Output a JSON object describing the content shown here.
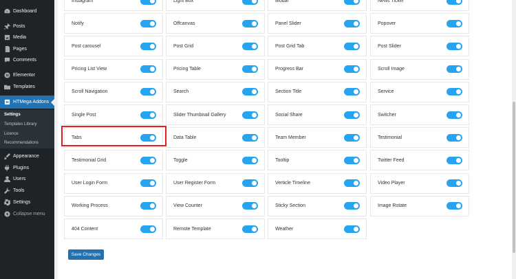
{
  "sidebar": {
    "items": [
      {
        "label": "Dashboard",
        "icon": "dashboard-icon"
      },
      {
        "label": "Posts",
        "icon": "pin-icon"
      },
      {
        "label": "Media",
        "icon": "media-icon"
      },
      {
        "label": "Pages",
        "icon": "pages-icon"
      },
      {
        "label": "Comments",
        "icon": "comment-icon"
      },
      {
        "label": "Elementor",
        "icon": "elementor-icon"
      },
      {
        "label": "Templates",
        "icon": "folder-icon"
      },
      {
        "label": "HTMega Addons",
        "icon": "htmega-icon"
      },
      {
        "label": "Appearance",
        "icon": "brush-icon"
      },
      {
        "label": "Plugins",
        "icon": "plugin-icon"
      },
      {
        "label": "Users",
        "icon": "user-icon"
      },
      {
        "label": "Tools",
        "icon": "wrench-icon"
      },
      {
        "label": "Settings",
        "icon": "settings-icon"
      },
      {
        "label": "Collapse menu",
        "icon": "collapse-icon"
      }
    ],
    "submenu": [
      "Settings",
      "Templates Library",
      "Licence",
      "Recommendations"
    ]
  },
  "widgets": [
    [
      {
        "label": "Instagram",
        "on": true
      },
      {
        "label": "Light Box",
        "on": true
      },
      {
        "label": "Modal",
        "on": true
      },
      {
        "label": "News Ticker",
        "on": true
      }
    ],
    [
      {
        "label": "Notify",
        "on": true
      },
      {
        "label": "Offcanvas",
        "on": true
      },
      {
        "label": "Panel Slider",
        "on": true
      },
      {
        "label": "Popover",
        "on": true
      }
    ],
    [
      {
        "label": "Post carousel",
        "on": true
      },
      {
        "label": "Post Grid",
        "on": true
      },
      {
        "label": "Post Grid Tab",
        "on": true
      },
      {
        "label": "Post Slider",
        "on": true
      }
    ],
    [
      {
        "label": "Pricing List View",
        "on": true
      },
      {
        "label": "Pricing Table",
        "on": true
      },
      {
        "label": "Progress Bar",
        "on": true
      },
      {
        "label": "Scroll Image",
        "on": true
      }
    ],
    [
      {
        "label": "Scroll Navigation",
        "on": true
      },
      {
        "label": "Search",
        "on": true
      },
      {
        "label": "Section Title",
        "on": true
      },
      {
        "label": "Service",
        "on": true
      }
    ],
    [
      {
        "label": "Single Post",
        "on": true
      },
      {
        "label": "Slider Thumbnail Gallery",
        "on": true
      },
      {
        "label": "Social Share",
        "on": true
      },
      {
        "label": "Switcher",
        "on": true
      }
    ],
    [
      {
        "label": "Tabs",
        "on": true
      },
      {
        "label": "Data Table",
        "on": true
      },
      {
        "label": "Team Member",
        "on": true
      },
      {
        "label": "Testimonial",
        "on": true
      }
    ],
    [
      {
        "label": "Testimonial Grid",
        "on": true
      },
      {
        "label": "Toggle",
        "on": true
      },
      {
        "label": "Tooltip",
        "on": true
      },
      {
        "label": "Twitter Feed",
        "on": true
      }
    ],
    [
      {
        "label": "User Login Form",
        "on": true
      },
      {
        "label": "User Register Form",
        "on": true
      },
      {
        "label": "Verticle Timeline",
        "on": true
      },
      {
        "label": "Video Player",
        "on": true
      }
    ],
    [
      {
        "label": "Working Process",
        "on": true
      },
      {
        "label": "View Counter",
        "on": true
      },
      {
        "label": "Sticky Section",
        "on": true
      },
      {
        "label": "Image Rotate",
        "on": true
      }
    ],
    [
      {
        "label": "404 Content",
        "on": true
      },
      {
        "label": "Remote Template",
        "on": true
      },
      {
        "label": "Weather",
        "on": true
      }
    ]
  ],
  "save_label": "Save Changes",
  "colors": {
    "toggle_on": "#27a4ef",
    "highlight": "#e31e24",
    "sidebar_bg": "#1d2327",
    "accent": "#2271b1"
  }
}
